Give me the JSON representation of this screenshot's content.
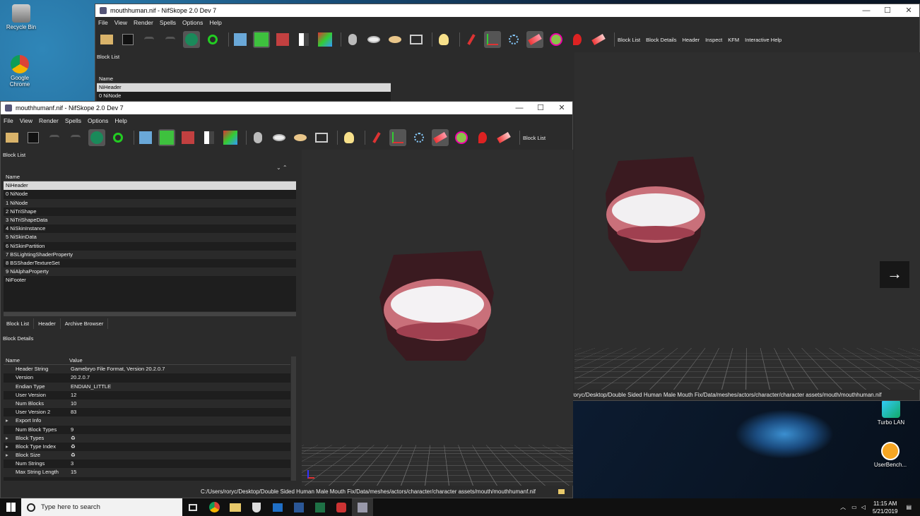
{
  "desktop": {
    "icons": [
      {
        "label": "Recycle Bin"
      },
      {
        "label": "Google Chrome"
      },
      {
        "label": "Turbo LAN"
      },
      {
        "label": "UserBench..."
      }
    ]
  },
  "back_window": {
    "title": "mouthhuman.nif - NifSkope 2.0 Dev 7",
    "menu": [
      "File",
      "View",
      "Render",
      "Spells",
      "Options",
      "Help"
    ],
    "toolbar_text": [
      "Block List",
      "Block Details",
      "Header",
      "Inspect",
      "KFM",
      "Interactive Help"
    ],
    "block_list_title": "Block List",
    "column": "Name",
    "rows": [
      "NiHeader",
      "0 NiNode"
    ],
    "path": "roryc/Desktop/Double Sided Human Male Mouth Fix/Data/meshes/actors/character/character assets/mouth/mouthhuman.nif"
  },
  "front_window": {
    "title": "mouthhumanf.nif - NifSkope 2.0 Dev 7",
    "menu": [
      "File",
      "View",
      "Render",
      "Spells",
      "Options",
      "Help"
    ],
    "toolbar_text": "Block List",
    "block_list_title": "Block List",
    "column": "Name",
    "rows": [
      "NiHeader",
      "0 NiNode",
      "1 NiNode",
      "2 NiTriShape",
      "3 NiTriShapeData",
      "4 NiSkinInstance",
      "5 NiSkinData",
      "6 NiSkinPartition",
      "7 BSLightingShaderProperty",
      "8 BSShaderTextureSet",
      "9 NiAlphaProperty",
      "NiFooter"
    ],
    "tabs": [
      "Block List",
      "Header",
      "Archive Browser"
    ],
    "details_title": "Block Details",
    "details_cols": [
      "Name",
      "Value"
    ],
    "details": [
      {
        "name": "Header String",
        "value": "Gamebryo File Format, Version 20.2.0.7",
        "exp": false
      },
      {
        "name": "Version",
        "value": "20.2.0.7",
        "exp": false
      },
      {
        "name": "Endian Type",
        "value": "ENDIAN_LITTLE",
        "exp": false
      },
      {
        "name": "User Version",
        "value": "12",
        "exp": false
      },
      {
        "name": "Num Blocks",
        "value": "10",
        "exp": false
      },
      {
        "name": "User Version 2",
        "value": "83",
        "exp": false
      },
      {
        "name": "Export Info",
        "value": "",
        "exp": true
      },
      {
        "name": "Num Block Types",
        "value": "9",
        "exp": false
      },
      {
        "name": "Block Types",
        "value": "♻",
        "exp": true
      },
      {
        "name": "Block Type Index",
        "value": "♻",
        "exp": true
      },
      {
        "name": "Block Size",
        "value": "♻",
        "exp": true
      },
      {
        "name": "Num Strings",
        "value": "3",
        "exp": false
      },
      {
        "name": "Max String Length",
        "value": "15",
        "exp": false
      }
    ],
    "path": "C:/Users/roryc/Desktop/Double Sided Human Male Mouth Fix/Data/meshes/actors/character/character assets/mouth/mouthhumanf.nif"
  },
  "taskbar": {
    "search_placeholder": "Type here to search",
    "time": "11:15 AM",
    "date": "5/21/2019"
  }
}
